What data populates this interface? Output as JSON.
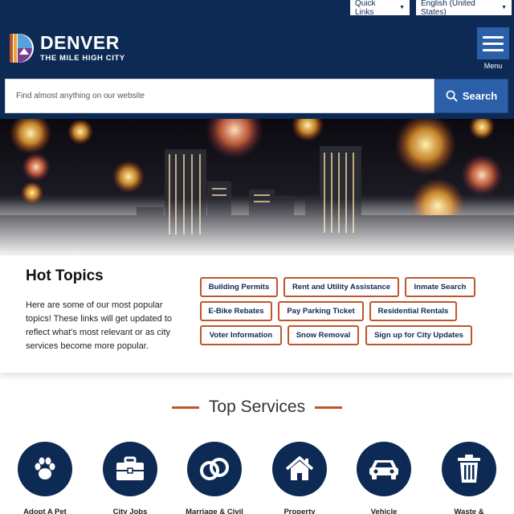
{
  "utility": {
    "quick_links": "Quick Links",
    "language": "English (United States)"
  },
  "brand": {
    "name": "DENVER",
    "tagline": "THE MILE HIGH CITY"
  },
  "menu": {
    "label": "Menu"
  },
  "search": {
    "placeholder": "Find almost anything on our website",
    "button_label": "Search"
  },
  "hot_topics": {
    "title": "Hot Topics",
    "description": "Here are some of our most popular topics! These links will get updated to reflect what's most relevant or as city services become more popular.",
    "links": [
      "Building Permits",
      "Rent and Utility Assistance",
      "Inmate Search",
      "E-Bike Rebates",
      "Pay Parking Ticket",
      "Residential Rentals",
      "Voter Information",
      "Snow Removal",
      "Sign up for City Updates"
    ]
  },
  "top_services": {
    "title": "Top Services",
    "items": [
      {
        "label": "Adopt A Pet",
        "icon": "paw-icon"
      },
      {
        "label": "City Jobs",
        "icon": "briefcase-icon"
      },
      {
        "label": "Marriage & Civil",
        "icon": "rings-icon"
      },
      {
        "label": "Property",
        "icon": "house-icon"
      },
      {
        "label": "Vehicle",
        "icon": "car-icon"
      },
      {
        "label": "Waste &",
        "icon": "trash-icon"
      }
    ]
  },
  "colors": {
    "header_navy": "#0d2a55",
    "button_blue": "#2b5fa8",
    "accent_orange": "#c0552c"
  }
}
